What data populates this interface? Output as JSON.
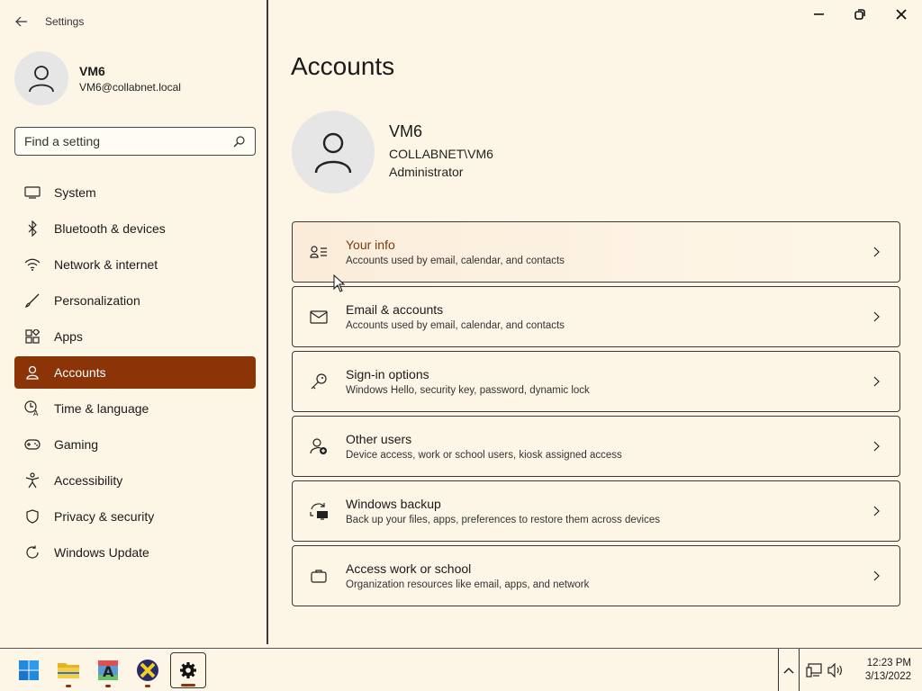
{
  "app": {
    "title": "Settings"
  },
  "user": {
    "name": "VM6",
    "email": "VM6@collabnet.local"
  },
  "search": {
    "placeholder": "Find a setting"
  },
  "nav": {
    "items": [
      {
        "label": "System",
        "icon": "monitor-icon"
      },
      {
        "label": "Bluetooth & devices",
        "icon": "bluetooth-icon"
      },
      {
        "label": "Network & internet",
        "icon": "wifi-icon"
      },
      {
        "label": "Personalization",
        "icon": "brush-icon"
      },
      {
        "label": "Apps",
        "icon": "apps-icon"
      },
      {
        "label": "Accounts",
        "icon": "person-icon",
        "active": true
      },
      {
        "label": "Time & language",
        "icon": "globe-clock-icon"
      },
      {
        "label": "Gaming",
        "icon": "gamepad-icon"
      },
      {
        "label": "Accessibility",
        "icon": "accessibility-icon"
      },
      {
        "label": "Privacy & security",
        "icon": "shield-icon"
      },
      {
        "label": "Windows Update",
        "icon": "update-icon"
      }
    ]
  },
  "page": {
    "title": "Accounts"
  },
  "profile": {
    "name": "VM6",
    "domain_user": "COLLABNET\\VM6",
    "role": "Administrator"
  },
  "cards": [
    {
      "title": "Your info",
      "subtitle": "Accounts used by email, calendar, and contacts",
      "icon": "contact-card-icon"
    },
    {
      "title": "Email & accounts",
      "subtitle": "Accounts used by email, calendar, and contacts",
      "icon": "mail-icon"
    },
    {
      "title": "Sign-in options",
      "subtitle": "Windows Hello, security key, password, dynamic lock",
      "icon": "key-icon"
    },
    {
      "title": "Other users",
      "subtitle": "Device access, work or school users, kiosk assigned access",
      "icon": "add-user-icon"
    },
    {
      "title": "Windows backup",
      "subtitle": "Back up your files, apps, preferences to restore them across devices",
      "icon": "backup-icon"
    },
    {
      "title": "Access work or school",
      "subtitle": "Organization resources like email, apps, and network",
      "icon": "briefcase-icon"
    }
  ],
  "taskbar": {
    "apps": [
      "start-icon",
      "file-explorer-icon",
      "font-app-icon",
      "x-app-icon",
      "settings-gear-icon"
    ],
    "clock": {
      "time": "12:23 PM",
      "date": "3/13/2022"
    }
  },
  "colors": {
    "accent": "#8a3408",
    "background": "#fdf6e6"
  }
}
